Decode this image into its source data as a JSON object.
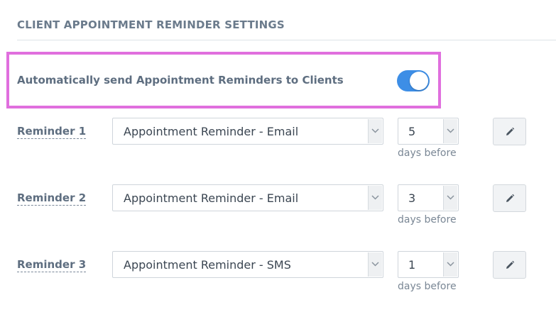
{
  "section": {
    "title": "CLIENT APPOINTMENT REMINDER SETTINGS"
  },
  "auto_send": {
    "label": "Automatically send Appointment Reminders to Clients",
    "enabled": true,
    "highlight_color": "#e06fde",
    "toggle_color": "#3d8ee6"
  },
  "reminders": [
    {
      "label": "Reminder 1",
      "template": "Appointment Reminder - Email",
      "days": "5",
      "days_suffix": "days before"
    },
    {
      "label": "Reminder 2",
      "template": "Appointment Reminder - Email",
      "days": "3",
      "days_suffix": "days before"
    },
    {
      "label": "Reminder 3",
      "template": "Appointment Reminder - SMS",
      "days": "1",
      "days_suffix": "days before"
    }
  ],
  "icons": {
    "dropdown": "chevron-down-icon",
    "edit": "pencil-icon"
  }
}
